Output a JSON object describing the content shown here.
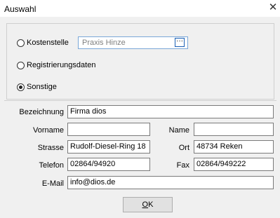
{
  "window": {
    "title": "Auswahl",
    "close_glyph": "✕"
  },
  "options": {
    "kostenstelle_label": "Kostenstelle",
    "kostenstelle_value": "Praxis Hinze",
    "lookup_button_label": "···",
    "registrierungsdaten_label": "Registrierungsdaten",
    "sonstige_label": "Sonstige",
    "selected": "sonstige"
  },
  "form": {
    "bezeichnung_label": "Bezeichnung",
    "bezeichnung_value": "Firma dios",
    "vorname_label": "Vorname",
    "vorname_value": "",
    "name_label": "Name",
    "name_value": "",
    "strasse_label": "Strasse",
    "strasse_value": "Rudolf-Diesel-Ring 18",
    "ort_label": "Ort",
    "ort_value": "48734 Reken",
    "telefon_label": "Telefon",
    "telefon_value": "02864/94920",
    "fax_label": "Fax",
    "fax_value": "02864/949222",
    "email_label": "E-Mail",
    "email_value": "info@dios.de"
  },
  "footer": {
    "ok_label": "OK",
    "ok_accel": "O",
    "ok_rest": "K"
  }
}
